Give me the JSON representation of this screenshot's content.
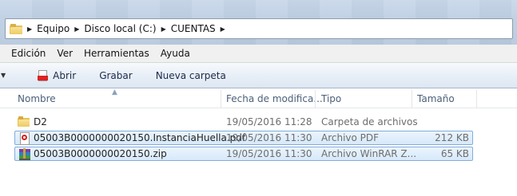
{
  "address_bar": {
    "breadcrumbs": [
      "Equipo",
      "Disco local (C:)",
      "CUENTAS"
    ]
  },
  "menu": {
    "items": [
      "Edición",
      "Ver",
      "Herramientas",
      "Ayuda"
    ]
  },
  "toolbar": {
    "open_label": "Abrir",
    "burn_label": "Grabar",
    "new_folder_label": "Nueva carpeta"
  },
  "columns": {
    "name": "Nombre",
    "date": "Fecha de modifica...",
    "type": "Tipo",
    "size": "Tamaño"
  },
  "files": [
    {
      "name": "D2",
      "date": "19/05/2016 11:28",
      "type": "Carpeta de archivos",
      "size": "",
      "icon": "folder-icon"
    },
    {
      "name": "05003B0000000020150.InstanciaHuella.pdf",
      "date": "19/05/2016 11:30",
      "type": "Archivo PDF",
      "size": "212 KB",
      "icon": "pdf-file-icon"
    },
    {
      "name": "05003B0000000020150.zip",
      "date": "19/05/2016 11:30",
      "type": "Archivo WinRAR Z...",
      "size": "65 KB",
      "icon": "winrar-archive-icon"
    }
  ],
  "colors": {
    "selection_border": "#84acdd",
    "selection_fill": "#d7e9fa",
    "header_text": "#4c607a"
  }
}
